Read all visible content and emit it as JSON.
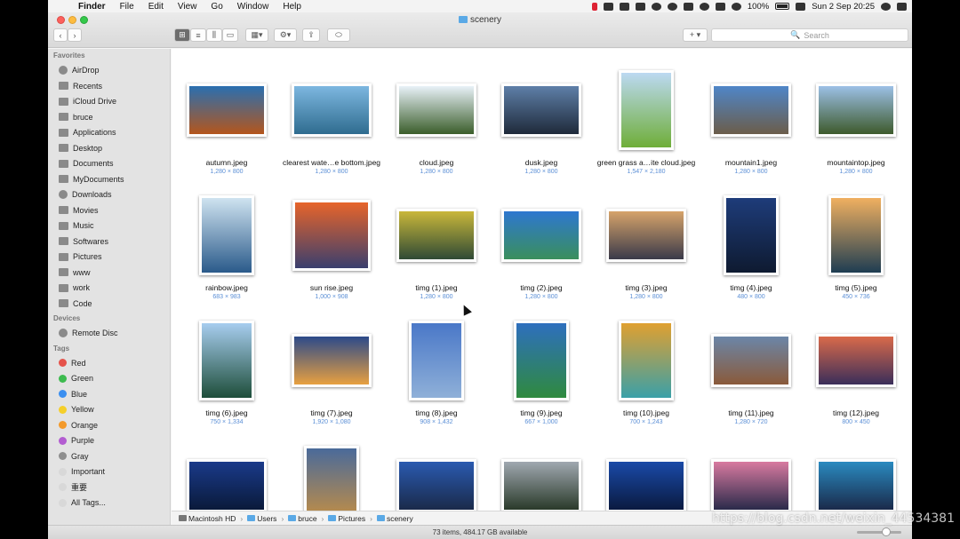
{
  "menubar": {
    "apple_glyph": "",
    "items": [
      "Finder",
      "File",
      "Edit",
      "View",
      "Go",
      "Window",
      "Help"
    ],
    "battery": "100%",
    "datetime": "Sun 2 Sep  20:25"
  },
  "window": {
    "title": "scenery",
    "search_placeholder": "Search",
    "add_label": "+ ▾",
    "icons": {
      "back": "‹",
      "forward": "›",
      "view_icon": "⊞",
      "view_list": "≡",
      "view_column": "⫼",
      "view_gallery": "▭",
      "group": "▦▾",
      "action": "⚙▾",
      "share": "⇪",
      "tags": "⬭",
      "search": "🔍"
    }
  },
  "sidebar": {
    "favorites_header": "Favorites",
    "favorites": [
      "AirDrop",
      "Recents",
      "iCloud Drive",
      "bruce",
      "Applications",
      "Desktop",
      "Documents",
      "MyDocuments",
      "Downloads",
      "Movies",
      "Music",
      "Softwares",
      "Pictures",
      "www",
      "work",
      "Code"
    ],
    "devices_header": "Devices",
    "devices": [
      "Remote Disc"
    ],
    "tags_header": "Tags",
    "tags": [
      {
        "label": "Red",
        "color": "#e5534b"
      },
      {
        "label": "Green",
        "color": "#3dbb4f"
      },
      {
        "label": "Blue",
        "color": "#3b8ff0"
      },
      {
        "label": "Yellow",
        "color": "#f5cf2a"
      },
      {
        "label": "Orange",
        "color": "#f39a2b"
      },
      {
        "label": "Purple",
        "color": "#b35dd1"
      },
      {
        "label": "Gray",
        "color": "#8e8e8e"
      },
      {
        "label": "Important",
        "color": "#d8d8d8"
      },
      {
        "label": "重要",
        "color": "#d8d8d8"
      },
      {
        "label": "All Tags...",
        "color": "#d8d8d8"
      }
    ]
  },
  "files": [
    {
      "name": "autumn.jpeg",
      "dims": "1,280 × 800",
      "c1": "#2a6fb0",
      "c2": "#b4561c"
    },
    {
      "name": "clearest wate…e bottom.jpeg",
      "dims": "1,280 × 800",
      "c1": "#7db7e0",
      "c2": "#2f6c8f"
    },
    {
      "name": "cloud.jpeg",
      "dims": "1,280 × 800",
      "c1": "#e8f1f8",
      "c2": "#3b5e2b"
    },
    {
      "name": "dusk.jpeg",
      "dims": "1,280 × 800",
      "c1": "#5e7fa8",
      "c2": "#1f2a3a"
    },
    {
      "name": "green grass a…ite cloud.jpeg",
      "dims": "1,547 × 2,180",
      "c1": "#bcd9f2",
      "c2": "#6fae38"
    },
    {
      "name": "mountain1.jpeg",
      "dims": "1,280 × 800",
      "c1": "#4f86c8",
      "c2": "#6b5d4a"
    },
    {
      "name": "mountaintop.jpeg",
      "dims": "1,280 × 800",
      "c1": "#9cc0e6",
      "c2": "#3e5a2c"
    },
    {
      "name": "rainbow.jpeg",
      "dims": "683 × 983",
      "c1": "#cfe3f0",
      "c2": "#2a5a8a"
    },
    {
      "name": "sun rise.jpeg",
      "dims": "1,000 × 908",
      "c1": "#e7642a",
      "c2": "#3a3f6e"
    },
    {
      "name": "timg (1).jpeg",
      "dims": "1,280 × 800",
      "c1": "#c9b73a",
      "c2": "#2f4a35"
    },
    {
      "name": "timg (2).jpeg",
      "dims": "1,280 × 800",
      "c1": "#2e77d0",
      "c2": "#3a8f5c"
    },
    {
      "name": "timg (3).jpeg",
      "dims": "1,280 × 800",
      "c1": "#d6a36a",
      "c2": "#3a3a4a"
    },
    {
      "name": "timg (4).jpeg",
      "dims": "480 × 800",
      "c1": "#1e3c7a",
      "c2": "#0e1a30"
    },
    {
      "name": "timg (5).jpeg",
      "dims": "450 × 736",
      "c1": "#f0b060",
      "c2": "#1e3d52"
    },
    {
      "name": "timg (6).jpeg",
      "dims": "750 × 1,334",
      "c1": "#a7cdef",
      "c2": "#1e4e3a"
    },
    {
      "name": "timg (7).jpeg",
      "dims": "1,920 × 1,080",
      "c1": "#2c4a8a",
      "c2": "#e8a040"
    },
    {
      "name": "timg (8).jpeg",
      "dims": "908 × 1,432",
      "c1": "#4a78c8",
      "c2": "#8fb0d8"
    },
    {
      "name": "timg (9).jpeg",
      "dims": "667 × 1,000",
      "c1": "#2e6fbe",
      "c2": "#2f8a3e"
    },
    {
      "name": "timg (10).jpeg",
      "dims": "700 × 1,243",
      "c1": "#e0a030",
      "c2": "#3aa0a8"
    },
    {
      "name": "timg (11).jpeg",
      "dims": "1,280 × 720",
      "c1": "#6b86a8",
      "c2": "#8a5a3a"
    },
    {
      "name": "timg (12).jpeg",
      "dims": "800 × 450",
      "c1": "#d96a4a",
      "c2": "#3a2e5a"
    },
    {
      "name": "",
      "dims": "",
      "c1": "#1a3a8a",
      "c2": "#0a1a3a"
    },
    {
      "name": "",
      "dims": "",
      "c1": "#4a6a9a",
      "c2": "#c89040"
    },
    {
      "name": "",
      "dims": "",
      "c1": "#2a5ab0",
      "c2": "#1a2a4a"
    },
    {
      "name": "",
      "dims": "",
      "c1": "#a0a8b0",
      "c2": "#2a3a2a"
    },
    {
      "name": "",
      "dims": "",
      "c1": "#1a4aa8",
      "c2": "#0a1a40"
    },
    {
      "name": "",
      "dims": "",
      "c1": "#d87aa0",
      "c2": "#2a2a4a"
    },
    {
      "name": "",
      "dims": "",
      "c1": "#2a8ac0",
      "c2": "#1a2a4a"
    }
  ],
  "pathbar": [
    "Macintosh HD",
    "Users",
    "bruce",
    "Pictures",
    "scenery"
  ],
  "statusbar": "73 items, 484.17 GB available",
  "watermark": "https://blog.csdn.net/weixin_44534381"
}
